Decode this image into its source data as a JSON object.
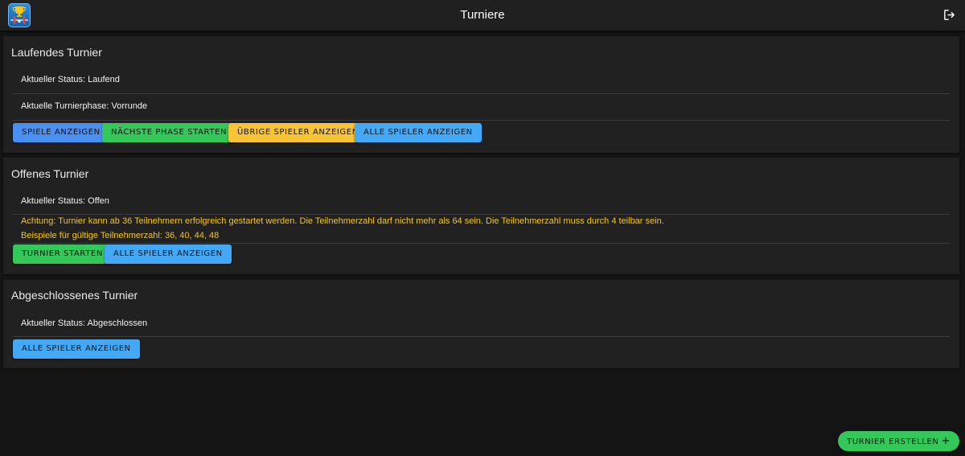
{
  "header": {
    "title": "Turniere",
    "logo_icon": "trophy-foosball-logo",
    "logout_icon": "logout-icon"
  },
  "cards": {
    "running": {
      "title": "Laufendes Turnier",
      "status": "Aktueller Status: Laufend",
      "phase": "Aktuelle Turnierphase: Vorrunde",
      "buttons": {
        "show_games": "SPIELE ANZEIGEN",
        "next_phase": "NÄCHSTE PHASE STARTEN",
        "remaining_players": "ÜBRIGE SPIELER ANZEIGEN",
        "all_players": "ALLE SPIELER ANZEIGEN"
      }
    },
    "open": {
      "title": "Offenes Turnier",
      "status": "Aktueller Status: Offen",
      "warning_line1": "Achtung: Turnier kann ab 36 Teilnehmern erfolgreich gestartet werden. Die Teilnehmerzahl darf nicht mehr als 64 sein. Die Teilnehmerzahl muss durch 4 teilbar sein.",
      "warning_line2": "Beispiele für gültige Teilnehmerzahl: 36, 40, 44, 48",
      "buttons": {
        "start": "TURNIER STARTEN",
        "all_players": "ALLE SPIELER ANZEIGEN"
      }
    },
    "finished": {
      "title": "Abgeschlossenes Turnier",
      "status": "Aktueller Status: Abgeschlossen",
      "buttons": {
        "all_players": "ALLE SPIELER ANZEIGEN"
      }
    }
  },
  "fab": {
    "label": "TURNIER ERSTELLEN",
    "icon": "+"
  },
  "colors": {
    "background": "#141414",
    "card": "#212121",
    "blue": "#4a8ff2",
    "green": "#34c759",
    "yellow": "#f7c435",
    "light_blue": "#43a8f5",
    "warning_text": "#f5c518"
  }
}
